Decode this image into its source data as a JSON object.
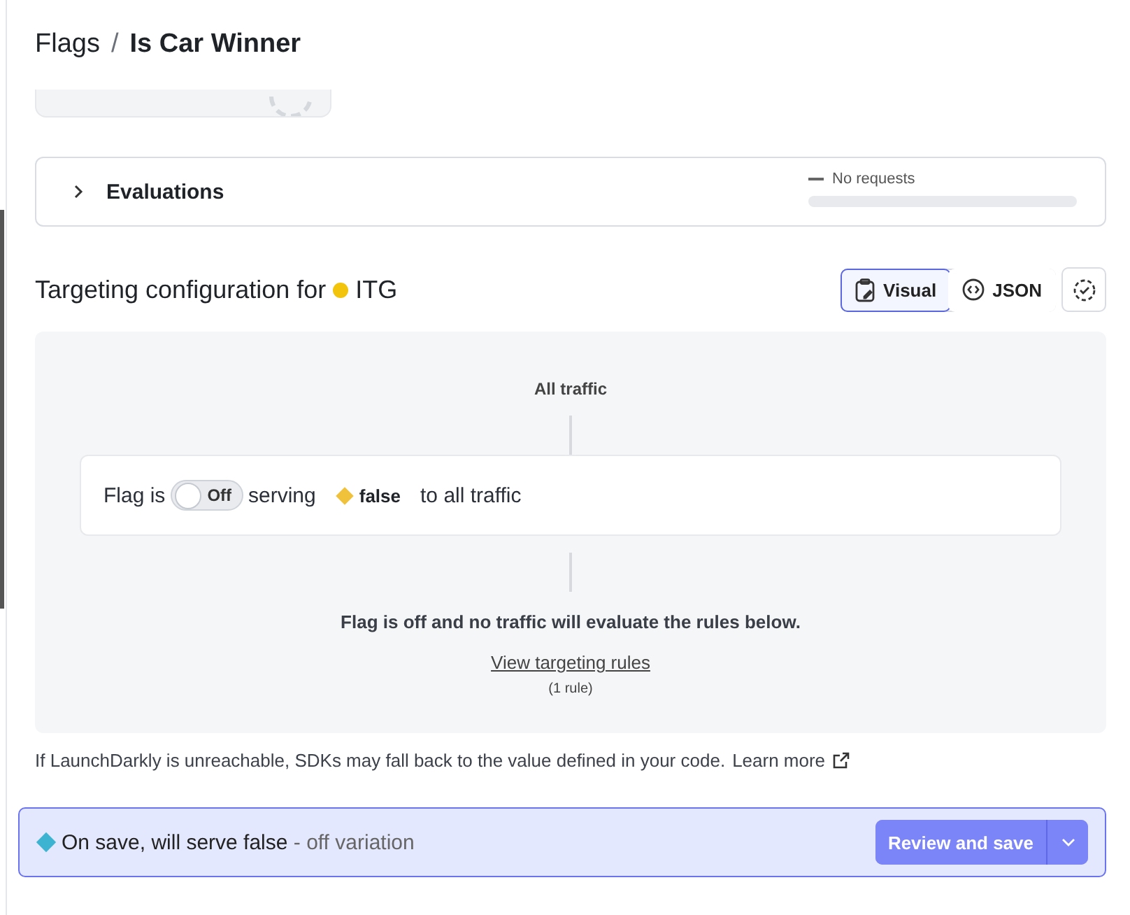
{
  "breadcrumb": {
    "parent": "Flags",
    "separator": "/",
    "current": "Is Car Winner"
  },
  "evaluations": {
    "title": "Evaluations",
    "expanded": false,
    "status": "No requests"
  },
  "targeting": {
    "title": "Targeting configuration for",
    "environment": "ITG",
    "views": [
      {
        "label": "Visual",
        "kind": "clipboard",
        "selected": true
      },
      {
        "label": "JSON",
        "kind": "code",
        "selected": false
      }
    ],
    "traffic_label": "All traffic",
    "flag_prefix": "Flag is",
    "toggle": {
      "label": "Off",
      "on": false
    },
    "serving": "serving",
    "variation": {
      "label": "false"
    },
    "suffix": "to all traffic",
    "notice": "Flag is off and no traffic will evaluate the rules below.",
    "rules_link": "View targeting rules",
    "rules_count": "(1 rule)"
  },
  "fallback_note": "If LaunchDarkly is unreachable, SDKs may fall back to the value defined in your code.",
  "learn_more": "Learn more",
  "save_bar": {
    "message": "On save, will serve false",
    "detail": "- off variation",
    "button": "Review and save"
  }
}
